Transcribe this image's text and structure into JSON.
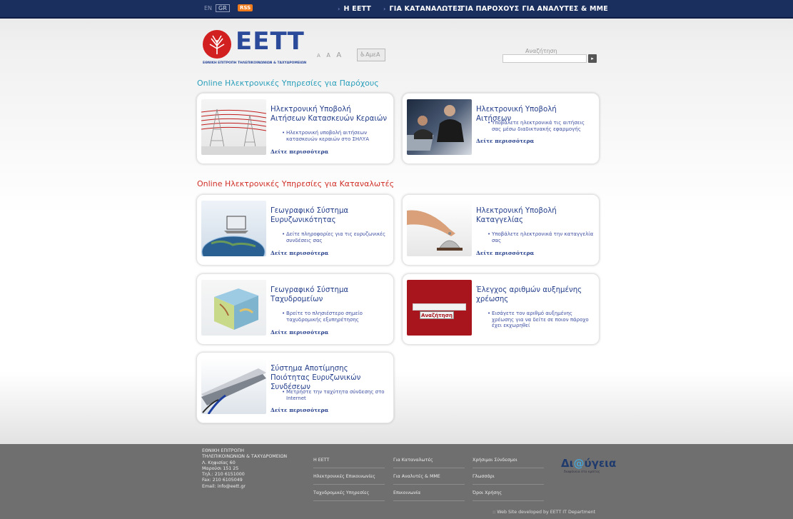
{
  "topbar": {
    "lang_en": "EN",
    "lang_gr": "GR",
    "rss": "RSS",
    "nav": [
      "Η ΕΕΤΤ",
      "ΓΙΑ ΚΑΤΑΝΑΛΩΤΕΣ",
      "ΓΙΑ ΠΑΡΟΧΟΥΣ",
      "ΓΙΑ ΑΝΑΛΥΤΕΣ & ΜΜΕ"
    ]
  },
  "header": {
    "logo_text": "ΕΕΤΤ",
    "logo_sub": "ΕΘΝΙΚΗ ΕΠΙΤΡΟΠΗ ΤΗΛΕΠΙΚΟΙΝΩΝΙΩΝ & ΤΑΧΥΔΡΟΜΕΙΩΝ",
    "font_sizes": [
      "A",
      "A",
      "A"
    ],
    "amea": "ΑμεΑ",
    "search_label": "Αναζήτηση",
    "search_value": "",
    "search_button": "▸"
  },
  "sections": {
    "providers_title": "Online Ηλεκτρονικές Υπηρεσίες για Παρόχους",
    "consumers_title": "Online Ηλεκτρονικές Υπηρεσίες για Καταναλωτές"
  },
  "cards": [
    {
      "title": "Ηλεκτρονική Υποβολή Αιτήσεων Κατασκευών Κεραιών",
      "bullet": "Ηλεκτρονική υποβολή αιτήσεων κατασκευών κεραιών στο ΣΗΛΥΑ",
      "more": "Δείτε περισσότερα"
    },
    {
      "title": "Ηλεκτρονική Υποβολή Αιτήσεων",
      "bullet": "Υποβάλετε ηλεκτρονικά τις αιτήσεις σας μέσω διαδικτυακής εφαρμογής",
      "more": "Δείτε περισσότερα"
    },
    {
      "title": "Γεωγραφικό Σύστημα Ευρυζωνικότητας",
      "bullet": "Δείτε πληροφορίες για τις ευρυζωνικές συνδέσεις σας",
      "more": "Δείτε περισσότερα"
    },
    {
      "title": "Ηλεκτρονική Υποβολή Καταγγελίας",
      "bullet": "Υποβάλετε ηλεκτρονικά την καταγγελία σας",
      "more": "Δείτε περισσότερα"
    },
    {
      "title": "Γεωγραφικό Σύστημα Ταχυδρομείων",
      "bullet": "Βρείτε το πλησιέστερο σημείο ταχυδρομικής εξυπηρέτησης",
      "more": "Δείτε περισσότερα"
    },
    {
      "title": "Έλεγχος αριθμών αυξημένης χρέωσης",
      "bullet": "Εισάγετε τον αριθμό αυξημένης χρέωσης για να δείτε σε ποιον πάροχο έχει εκχωρηθεί",
      "more": "",
      "image_button": "Αναζήτηση"
    },
    {
      "title": "Σύστημα Αποτίμησης Ποιότητας Ευρυζωνικών Συνδέσεων",
      "bullet": "Μετρήστε την ταχύτητα σύνδεσης στο Internet",
      "more": "Δείτε περισσότερα"
    }
  ],
  "footer": {
    "org_name": "ΕΘΝΙΚΗ ΕΠΙΤΡΟΠΗ\nΤΗΛΕΠΙΚΟΙΝΩΝΙΩΝ & ΤΑΧΥΔΡΟΜΕΙΩΝ",
    "address": [
      "Λ. Κηφισίας 60",
      "Μαρούσι 151 25",
      "Τηλ.: 210 6151000",
      "Fax: 210 6105049",
      "Email: info@eett.gr"
    ],
    "col1": [
      "Η ΕΕΤΤ",
      "Ηλεκτρονικές Επικοινωνίες",
      "Ταχυδρομικές Υπηρεσίες"
    ],
    "col2": [
      "Για Καταναλωτές",
      "Για Αναλυτές & ΜΜΕ",
      "Επικοινωνία"
    ],
    "col3": [
      "Χρήσιμοι Σύνδεσμοι",
      "Γλωσσάρι",
      "Όροι Χρήσης"
    ],
    "diavgeia_pre": "Δι",
    "diavgeia_at": "@",
    "diavgeia_post": "ύγεια",
    "diavgeia_sub": "διαφάνεια στο κράτος",
    "credit": ":: Web Site developed by EETT IT Department"
  }
}
